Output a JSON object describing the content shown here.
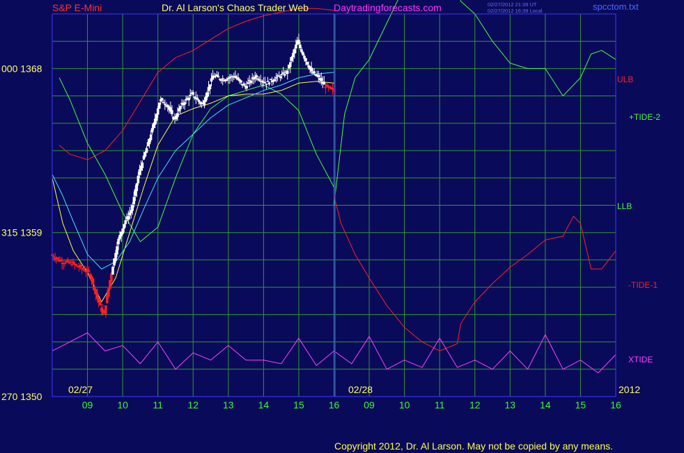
{
  "header": {
    "symbol": "S&P E-Mini",
    "title": "Dr. Al Larson's Chaos Trader Web",
    "site": "Daytradingforecasts.com",
    "timestamp_ut": "02/27/2012 21:39 UT",
    "timestamp_local": "02/27/2012 16:39 Local",
    "file": "spcctom.txt"
  },
  "footer": {
    "copyright": "Copyright 2012, Dr. Al Larson. May not be copied by any means."
  },
  "colors": {
    "background": "#0a0a5a",
    "grid": "#2e9a2e",
    "frame": "#3a3aff",
    "symbol": "#ff3030",
    "title": "#ffff66",
    "site": "#ff33ff",
    "timestamp": "#6a6aff",
    "file": "#4a6aff",
    "ulb": "#ff2020",
    "llb": "#40ff40",
    "tide_plus2": "#40ff40",
    "tide_minus1": "#ff2020",
    "xtide": "#ff40ff",
    "candle_up": "#ffffff",
    "candle_down": "#ff2020",
    "ma_fast": "#ffff40",
    "ma_slow": "#40e0ff",
    "copyright": "#ffff40",
    "ytick": "#ffff66",
    "xtick": "#30ff30",
    "datelabel": "#ffff66"
  },
  "chart_data": {
    "type": "line",
    "ylim": [
      1350,
      1371
    ],
    "y_ticks": [
      {
        "value": 1368,
        "label": "000  1368"
      },
      {
        "value": 1359,
        "label": "315  1359"
      },
      {
        "value": 1350,
        "label": "270  1350"
      }
    ],
    "x_ticks": [
      "09",
      "10",
      "11",
      "12",
      "13",
      "14",
      "15",
      "16",
      "09",
      "10",
      "11",
      "12",
      "13",
      "14",
      "15",
      "16"
    ],
    "date_labels": [
      "02/27",
      "02/28",
      "2012"
    ],
    "series": [
      {
        "name": "ULB",
        "label": "ULB",
        "x": [
          8.2,
          8.5,
          9.0,
          9.5,
          10.0,
          10.5,
          11.0,
          11.5,
          12.0,
          12.5,
          13.0,
          13.5,
          14.0,
          14.5,
          15.0,
          15.5,
          16.0
        ],
        "y": [
          1363.8,
          1363.3,
          1363.0,
          1363.5,
          1364.6,
          1366.2,
          1367.8,
          1368.6,
          1369.0,
          1369.6,
          1370.2,
          1370.6,
          1370.9,
          1371.1,
          1371.3,
          1371.3,
          1371.2
        ]
      },
      {
        "name": "LLB",
        "label": "LLB",
        "x": [
          8.2,
          8.5,
          9.0,
          9.5,
          10.0,
          10.5,
          11.0,
          11.5,
          12.0,
          12.5,
          13.0,
          13.5,
          14.0,
          14.5,
          15.0,
          15.5,
          16.0
        ],
        "y": [
          1367.5,
          1366.3,
          1363.9,
          1362.2,
          1360.1,
          1358.5,
          1359.3,
          1362.0,
          1364.4,
          1365.8,
          1366.5,
          1366.8,
          1367.1,
          1366.6,
          1365.7,
          1363.3,
          1361.5
        ]
      },
      {
        "name": "+TIDE-2",
        "label": "+TIDE-2",
        "x": [
          16.0,
          16.3,
          16.6,
          17.0,
          17.5,
          18.0,
          18.5,
          19.0,
          19.3,
          19.6,
          20.0,
          20.5,
          21.0,
          21.5,
          22.0,
          22.5,
          23.0,
          23.3,
          23.6,
          24.0
        ],
        "y": [
          1360.5,
          1365.5,
          1367.5,
          1368.5,
          1370.5,
          1372.5,
          1373.5,
          1374.0,
          1373.7,
          1371.7,
          1371.0,
          1369.5,
          1368.3,
          1368.0,
          1368.0,
          1366.5,
          1367.5,
          1368.8,
          1369.0,
          1368.5
        ]
      },
      {
        "name": "-TIDE-1",
        "label": "-TIDE-1",
        "x": [
          16.0,
          16.2,
          16.6,
          17.0,
          17.5,
          18.0,
          18.5,
          19.0,
          19.5,
          19.6,
          20.0,
          20.5,
          21.0,
          21.5,
          22.0,
          22.5,
          22.8,
          23.0,
          23.3,
          23.6,
          24.0
        ],
        "y": [
          1361.0,
          1359.5,
          1357.8,
          1356.5,
          1355.0,
          1353.8,
          1353.0,
          1352.5,
          1352.9,
          1354.0,
          1355.2,
          1356.2,
          1357.1,
          1357.8,
          1358.6,
          1358.8,
          1359.9,
          1359.5,
          1357.0,
          1357.0,
          1358.0
        ]
      },
      {
        "name": "XTIDE",
        "label": "XTIDE",
        "x": [
          8.0,
          8.5,
          9.0,
          9.5,
          10.0,
          10.5,
          11.0,
          11.5,
          12.0,
          12.5,
          13.0,
          13.5,
          14.0,
          14.5,
          15.0,
          15.5,
          16.0,
          16.5,
          17.0,
          17.5,
          18.0,
          18.5,
          19.0,
          19.5,
          20.0,
          20.5,
          21.0,
          21.5,
          22.0,
          22.5,
          23.0,
          23.5,
          24.0
        ],
        "y": [
          1352.5,
          1353.0,
          1353.5,
          1352.5,
          1352.8,
          1351.8,
          1353.0,
          1351.5,
          1352.4,
          1352.0,
          1352.8,
          1352.0,
          1352.0,
          1351.8,
          1353.2,
          1351.7,
          1352.5,
          1351.8,
          1353.3,
          1351.5,
          1352.0,
          1351.6,
          1353.2,
          1351.6,
          1352.0,
          1351.5,
          1352.5,
          1351.5,
          1353.4,
          1351.5,
          1352.0,
          1351.3,
          1352.3
        ]
      },
      {
        "name": "Price",
        "label": "",
        "x": [
          8.0,
          8.3,
          8.6,
          8.9,
          9.1,
          9.3,
          9.5,
          9.7,
          9.9,
          10.1,
          10.3,
          10.5,
          10.7,
          10.9,
          11.1,
          11.3,
          11.5,
          11.7,
          12.0,
          12.3,
          12.6,
          12.9,
          13.2,
          13.5,
          13.8,
          14.1,
          14.4,
          14.7,
          15.0,
          15.2,
          15.4,
          15.6,
          15.8,
          16.0
        ],
        "y": [
          1357.8,
          1357.4,
          1357.3,
          1357.0,
          1356.8,
          1355.5,
          1354.4,
          1356.6,
          1358.5,
          1359.6,
          1360.3,
          1362.3,
          1363.5,
          1364.8,
          1366.3,
          1366.0,
          1365.2,
          1366.0,
          1366.6,
          1366.0,
          1367.6,
          1367.4,
          1367.6,
          1367.0,
          1367.6,
          1367.2,
          1367.5,
          1367.8,
          1369.5,
          1368.6,
          1367.8,
          1367.5,
          1367.0,
          1366.8
        ]
      },
      {
        "name": "MA fast",
        "label": "",
        "x": [
          8.0,
          8.3,
          8.6,
          9.0,
          9.4,
          9.8,
          10.2,
          10.6,
          11.0,
          11.5,
          12.0,
          12.5,
          13.0,
          13.5,
          14.0,
          14.5,
          15.0,
          15.5,
          16.0
        ],
        "y": [
          1362.0,
          1359.5,
          1358.0,
          1356.8,
          1355.2,
          1356.5,
          1359.0,
          1361.5,
          1363.8,
          1365.4,
          1365.8,
          1366.1,
          1366.5,
          1366.6,
          1366.6,
          1366.8,
          1367.2,
          1367.3,
          1367.2
        ]
      },
      {
        "name": "MA slow",
        "label": "",
        "x": [
          8.0,
          8.3,
          8.6,
          9.0,
          9.4,
          9.8,
          10.2,
          10.6,
          11.0,
          11.5,
          12.0,
          12.5,
          13.0,
          13.5,
          14.0,
          14.5,
          15.0,
          15.5,
          16.0
        ],
        "y": [
          1362.2,
          1361.0,
          1359.6,
          1357.8,
          1357.0,
          1357.4,
          1358.5,
          1360.3,
          1362.0,
          1363.5,
          1364.4,
          1365.3,
          1366.0,
          1366.4,
          1366.8,
          1367.1,
          1367.5,
          1367.7,
          1367.8
        ]
      }
    ]
  }
}
